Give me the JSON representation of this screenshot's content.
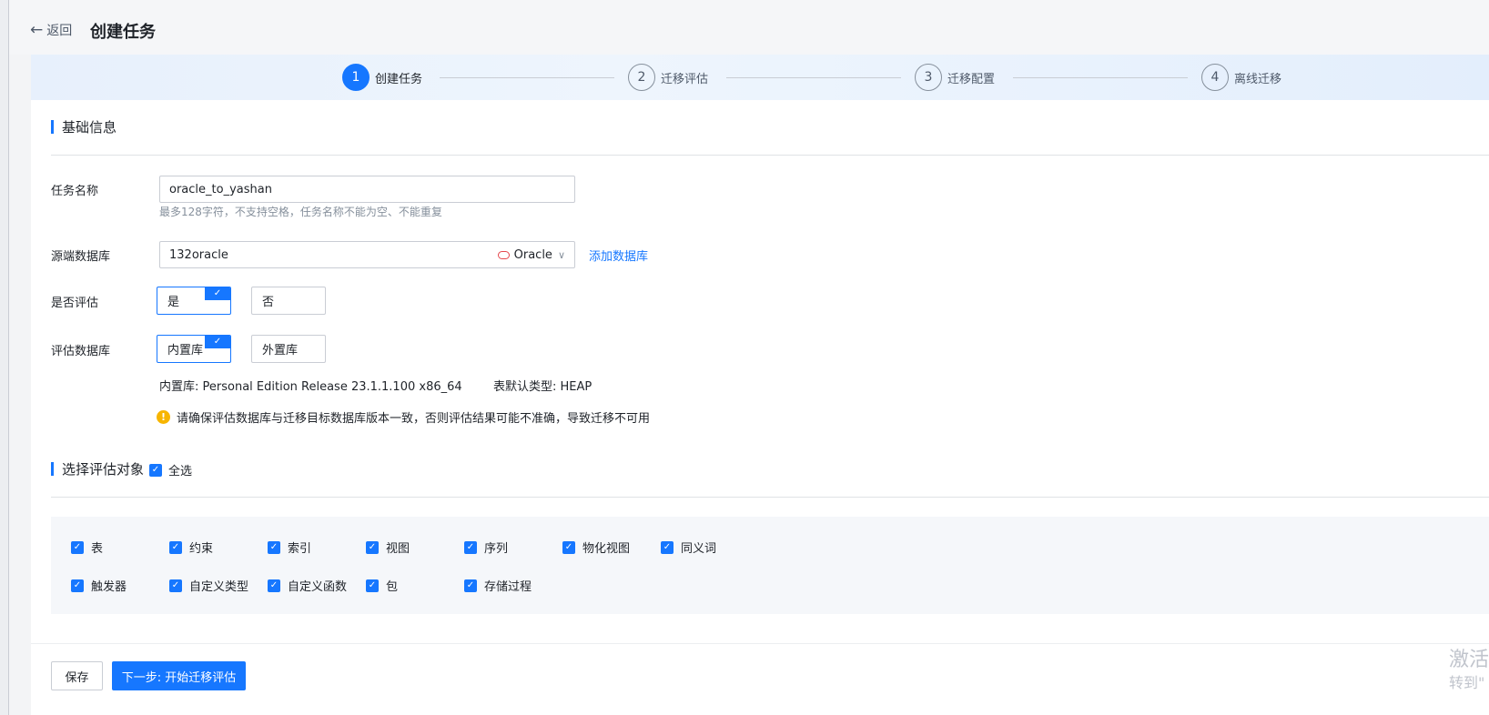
{
  "header": {
    "back_label": "返回",
    "title": "创建任务"
  },
  "steps": [
    {
      "num": "1",
      "label": "创建任务",
      "active": true
    },
    {
      "num": "2",
      "label": "迁移评估",
      "active": false
    },
    {
      "num": "3",
      "label": "迁移配置",
      "active": false
    },
    {
      "num": "4",
      "label": "离线迁移",
      "active": false
    }
  ],
  "basic": {
    "section_title": "基础信息",
    "task_name": {
      "label": "任务名称",
      "value": "oracle_to_yashan",
      "hint": "最多128字符，不支持空格，任务名称不能为空、不能重复"
    },
    "source_db": {
      "label": "源端数据库",
      "value": "132oracle",
      "db_type": "Oracle",
      "add_link": "添加数据库"
    },
    "evaluate": {
      "label": "是否评估",
      "options": [
        "是",
        "否"
      ],
      "selected": "是"
    },
    "eval_db": {
      "label": "评估数据库",
      "options": [
        "内置库",
        "外置库"
      ],
      "selected": "内置库",
      "info_builtin": "内置库:  Personal Edition Release 23.1.1.100 x86_64",
      "info_table_type": "表默认类型:  HEAP",
      "warning": "请确保评估数据库与迁移目标数据库版本一致，否则评估结果可能不准确，导致迁移不可用"
    }
  },
  "objects": {
    "section_title": "选择评估对象",
    "select_all": "全选",
    "items": [
      "表",
      "约束",
      "索引",
      "视图",
      "序列",
      "物化视图",
      "同义词",
      "触发器",
      "自定义类型",
      "自定义函数",
      "包",
      "存储过程"
    ]
  },
  "footer": {
    "save": "保存",
    "next": "下一步: 开始迁移评估"
  },
  "watermark": {
    "line1": "激活",
    "line2": "转到\""
  },
  "colors": {
    "primary": "#1677ff",
    "warning": "#f7b500",
    "oracle": "#e5484d"
  },
  "icons": [
    "arrow-left-icon",
    "check-icon",
    "warning-icon",
    "oracle-icon",
    "chevron-down-icon"
  ]
}
